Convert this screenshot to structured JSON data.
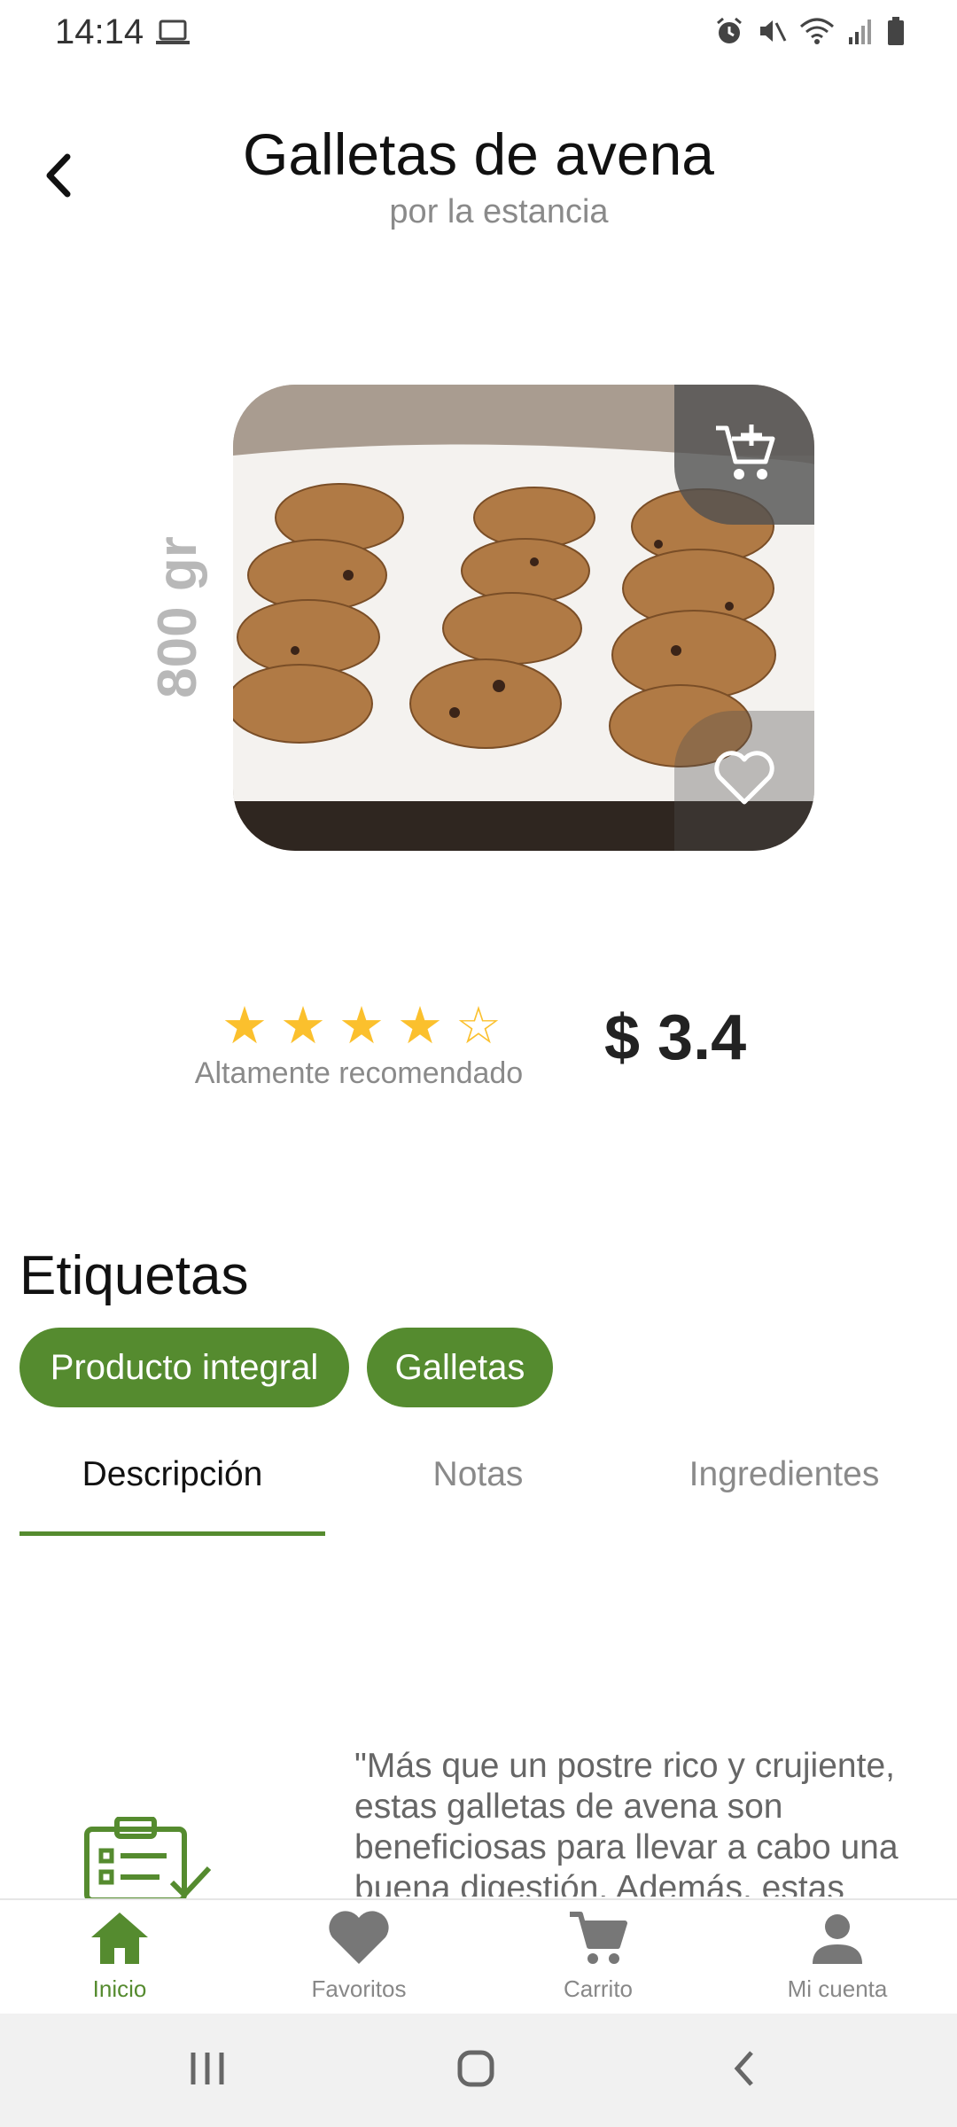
{
  "status_bar": {
    "time": "14:14",
    "icons": [
      "laptop-icon",
      "alarm-icon",
      "mute-icon",
      "wifi-icon",
      "signal-icon",
      "battery-icon"
    ]
  },
  "header": {
    "title": "Galletas de avena",
    "subtitle": "por la estancia",
    "back_icon": "back-arrow-icon"
  },
  "product": {
    "weight": "800 gr",
    "image_alt": "oatmeal cookies on a white cloth",
    "cart_add_icon": "cart-plus-icon",
    "favorite_icon": "heart-outline-icon",
    "rating": 4,
    "rating_max": 5,
    "rating_caption": "Altamente recomendado",
    "price": "$ 3.4"
  },
  "tags": {
    "title": "Etiquetas",
    "items": [
      "Producto integral",
      "Galletas"
    ]
  },
  "tabs": {
    "items": [
      {
        "label": "Descripción",
        "active": true
      },
      {
        "label": "Notas",
        "active": false
      },
      {
        "label": "Ingredientes",
        "active": false
      }
    ]
  },
  "description": {
    "text": "\"Más que un postre rico y crujiente, estas galletas de avena son beneficiosas para llevar a cabo una buena digestión. Además, estas"
  },
  "bottom_nav": {
    "items": [
      {
        "label": "Inicio",
        "icon": "home-icon",
        "active": true
      },
      {
        "label": "Favoritos",
        "icon": "heart-icon",
        "active": false
      },
      {
        "label": "Carrito",
        "icon": "cart-icon",
        "active": false
      },
      {
        "label": "Mi cuenta",
        "icon": "account-icon",
        "active": false
      }
    ]
  },
  "colors": {
    "accent": "#558b2f",
    "star": "#fbc02d",
    "muted_text": "#8a8a8a"
  }
}
